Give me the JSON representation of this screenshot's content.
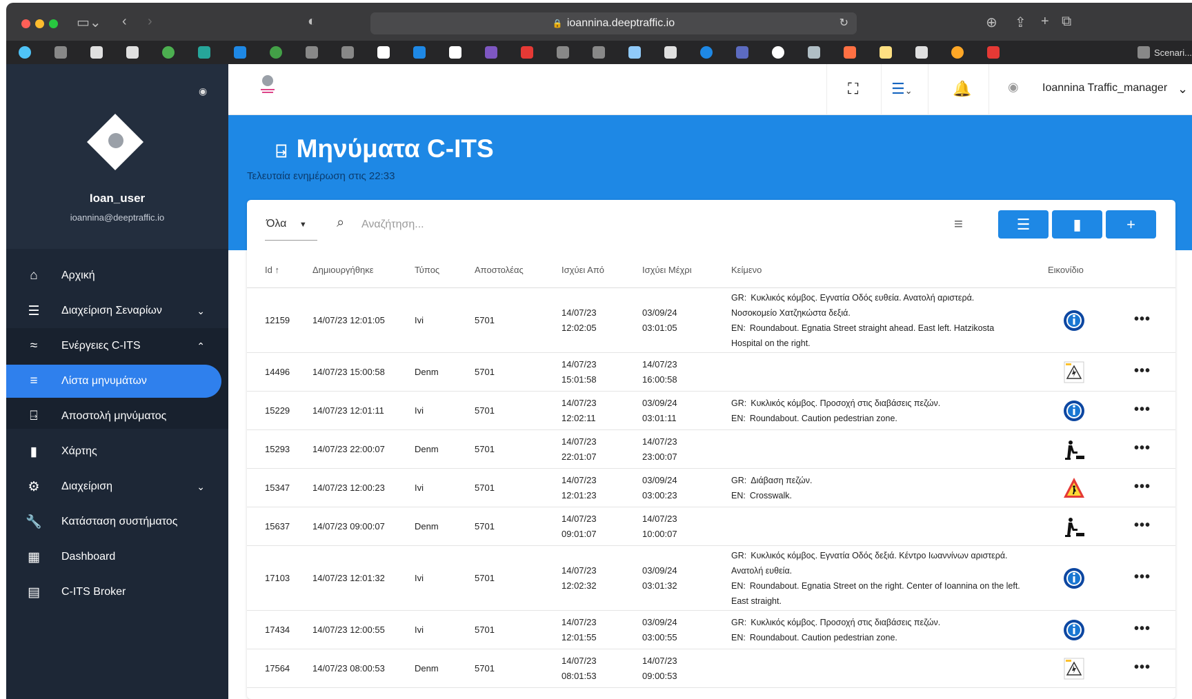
{
  "browser": {
    "url": "ioannina.deeptraffic.io",
    "last_bookmark": "Scenari..."
  },
  "sidebar": {
    "user_name": "Ioan_user",
    "user_email": "ioannina@deeptraffic.io",
    "items": [
      {
        "label": "Αρχική",
        "icon": "home-icon"
      },
      {
        "label": "Διαχείριση Σεναρίων",
        "icon": "menu-icon"
      },
      {
        "label": "Ενέργειες C-ITS",
        "icon": "signal-icon"
      },
      {
        "label": "Λίστα μηνυμάτων",
        "icon": "list-icon"
      },
      {
        "label": "Αποστολή μηνύματος",
        "icon": "send-icon"
      },
      {
        "label": "Χάρτης",
        "icon": "map-icon"
      },
      {
        "label": "Διαχείριση",
        "icon": "settings-icon"
      },
      {
        "label": "Κατάσταση συστήματος",
        "icon": "wrench-icon"
      },
      {
        "label": "Dashboard",
        "icon": "dashboard-icon"
      },
      {
        "label": "C-ITS Broker",
        "icon": "chat-icon"
      }
    ]
  },
  "header": {
    "user": "Ioannina Traffic_manager"
  },
  "page": {
    "title": "Μηνύματα C-ITS",
    "subtitle": "Τελευταία ενημέρωση στις 22:33"
  },
  "toolbar": {
    "filter_value": "Όλα",
    "search_placeholder": "Αναζήτηση..."
  },
  "table": {
    "headers": [
      "Id ↑",
      "Δημιουργήθηκε",
      "Τύπος",
      "Αποστολέας",
      "Ισχύει Από",
      "Ισχύει Μέχρι",
      "Κείμενο",
      "Εικονίδιο"
    ],
    "rows": [
      {
        "id": "12159",
        "created": "14/07/23 12:01:05",
        "type": "Ivi",
        "sender": "5701",
        "from_d": "14/07/23",
        "from_t": "12:02:05",
        "to_d": "03/09/24",
        "to_t": "03:01:05",
        "gr": "Κυκλικός κόμβος. Εγνατία Οδός ευθεία. Ανατολή αριστερά. Νοσοκομείο Χατζηκώστα δεξιά.",
        "en": "Roundabout. Egnatia Street straight ahead. East left. Hatzikosta Hospital on the right.",
        "icon": "info"
      },
      {
        "id": "14496",
        "created": "14/07/23 15:00:58",
        "type": "Denm",
        "sender": "5701",
        "from_d": "14/07/23",
        "from_t": "15:01:58",
        "to_d": "14/07/23",
        "to_t": "16:00:58",
        "gr": "",
        "en": "",
        "icon": "sign"
      },
      {
        "id": "15229",
        "created": "14/07/23 12:01:11",
        "type": "Ivi",
        "sender": "5701",
        "from_d": "14/07/23",
        "from_t": "12:02:11",
        "to_d": "03/09/24",
        "to_t": "03:01:11",
        "gr": "Κυκλικός κόμβος. Προσοχή στις διαβάσεις πεζών.",
        "en": "Roundabout. Caution pedestrian zone.",
        "icon": "info"
      },
      {
        "id": "15293",
        "created": "14/07/23 22:00:07",
        "type": "Denm",
        "sender": "5701",
        "from_d": "14/07/23",
        "from_t": "22:01:07",
        "to_d": "14/07/23",
        "to_t": "23:00:07",
        "gr": "",
        "en": "",
        "icon": "worker"
      },
      {
        "id": "15347",
        "created": "14/07/23 12:00:23",
        "type": "Ivi",
        "sender": "5701",
        "from_d": "14/07/23",
        "from_t": "12:01:23",
        "to_d": "03/09/24",
        "to_t": "03:00:23",
        "gr": "Διάβαση πεζών.",
        "en": "Crosswalk.",
        "icon": "warning"
      },
      {
        "id": "15637",
        "created": "14/07/23 09:00:07",
        "type": "Denm",
        "sender": "5701",
        "from_d": "14/07/23",
        "from_t": "09:01:07",
        "to_d": "14/07/23",
        "to_t": "10:00:07",
        "gr": "",
        "en": "",
        "icon": "worker"
      },
      {
        "id": "17103",
        "created": "14/07/23 12:01:32",
        "type": "Ivi",
        "sender": "5701",
        "from_d": "14/07/23",
        "from_t": "12:02:32",
        "to_d": "03/09/24",
        "to_t": "03:01:32",
        "gr": "Κυκλικός κόμβος. Εγνατία Οδός δεξιά. Κέντρο Ιωαννίνων αριστερά. Ανατολή ευθεία.",
        "en": "Roundabout. Egnatia Street on the right. Center of Ioannina on the left. East straight.",
        "icon": "info"
      },
      {
        "id": "17434",
        "created": "14/07/23 12:00:55",
        "type": "Ivi",
        "sender": "5701",
        "from_d": "14/07/23",
        "from_t": "12:01:55",
        "to_d": "03/09/24",
        "to_t": "03:00:55",
        "gr": "Κυκλικός κόμβος. Προσοχή στις διαβάσεις πεζών.",
        "en": "Roundabout. Caution pedestrian zone.",
        "icon": "info"
      },
      {
        "id": "17564",
        "created": "14/07/23 08:00:53",
        "type": "Denm",
        "sender": "5701",
        "from_d": "14/07/23",
        "from_t": "08:01:53",
        "to_d": "14/07/23",
        "to_t": "09:00:53",
        "gr": "",
        "en": "",
        "icon": "sign"
      }
    ],
    "text_prefix_gr": "GR:",
    "text_prefix_en": "EN:",
    "more_label": "•••"
  },
  "colors": {
    "sidebar": "#1d2736",
    "accent": "#1e88e5",
    "active": "#2f80ed"
  }
}
